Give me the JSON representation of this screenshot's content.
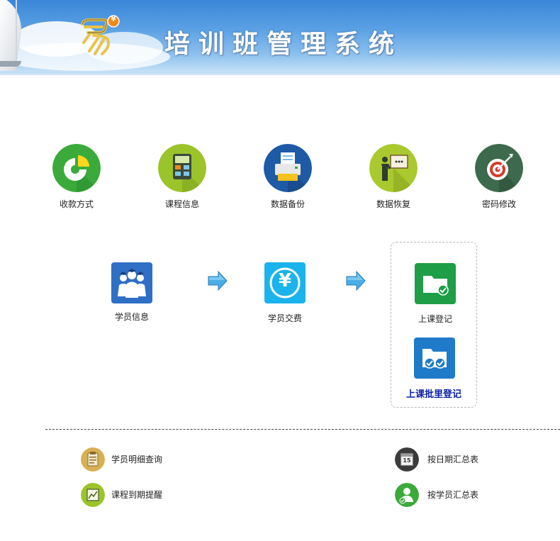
{
  "header": {
    "title": "培训班管理系统",
    "logo_icon": "yi-logo-icon",
    "logo_badge": "¥"
  },
  "top_items": [
    {
      "label": "收款方式",
      "icon": "pie-chart-icon",
      "color": "#3aaa3a"
    },
    {
      "label": "课程信息",
      "icon": "calculator-icon",
      "color": "#9bc42a"
    },
    {
      "label": "数据备份",
      "icon": "printer-icon",
      "color": "#1e5aa6"
    },
    {
      "label": "数据恢复",
      "icon": "presentation-icon",
      "color": "#a9c92f"
    },
    {
      "label": "密码修改",
      "icon": "target-icon",
      "color": "#3d6a4c"
    }
  ],
  "flow": {
    "student_info": {
      "label": "学员信息",
      "icon": "students-icon",
      "color": "#2f6fc6"
    },
    "student_payment": {
      "label": "学员交费",
      "icon": "yen-icon",
      "color": "#1ab3ec",
      "glyph": "¥"
    },
    "class_register": {
      "label": "上课登记",
      "icon": "folder-check-icon",
      "color": "#1e9e46"
    },
    "batch_register": {
      "label": "上课批里登记",
      "icon": "folder-double-check-icon",
      "color": "#1f7ac9"
    }
  },
  "links": [
    {
      "label": "学员明细查询",
      "icon": "clipboard-icon",
      "color": "#d8b054"
    },
    {
      "label": "课程到期提醒",
      "icon": "chart-board-icon",
      "color": "#9bc42a"
    },
    {
      "label": "按日期汇总表",
      "icon": "calendar-icon",
      "color": "#3b3b3b",
      "glyph": "15"
    },
    {
      "label": "按学员汇总表",
      "icon": "user-check-icon",
      "color": "#3aaa3a"
    }
  ]
}
